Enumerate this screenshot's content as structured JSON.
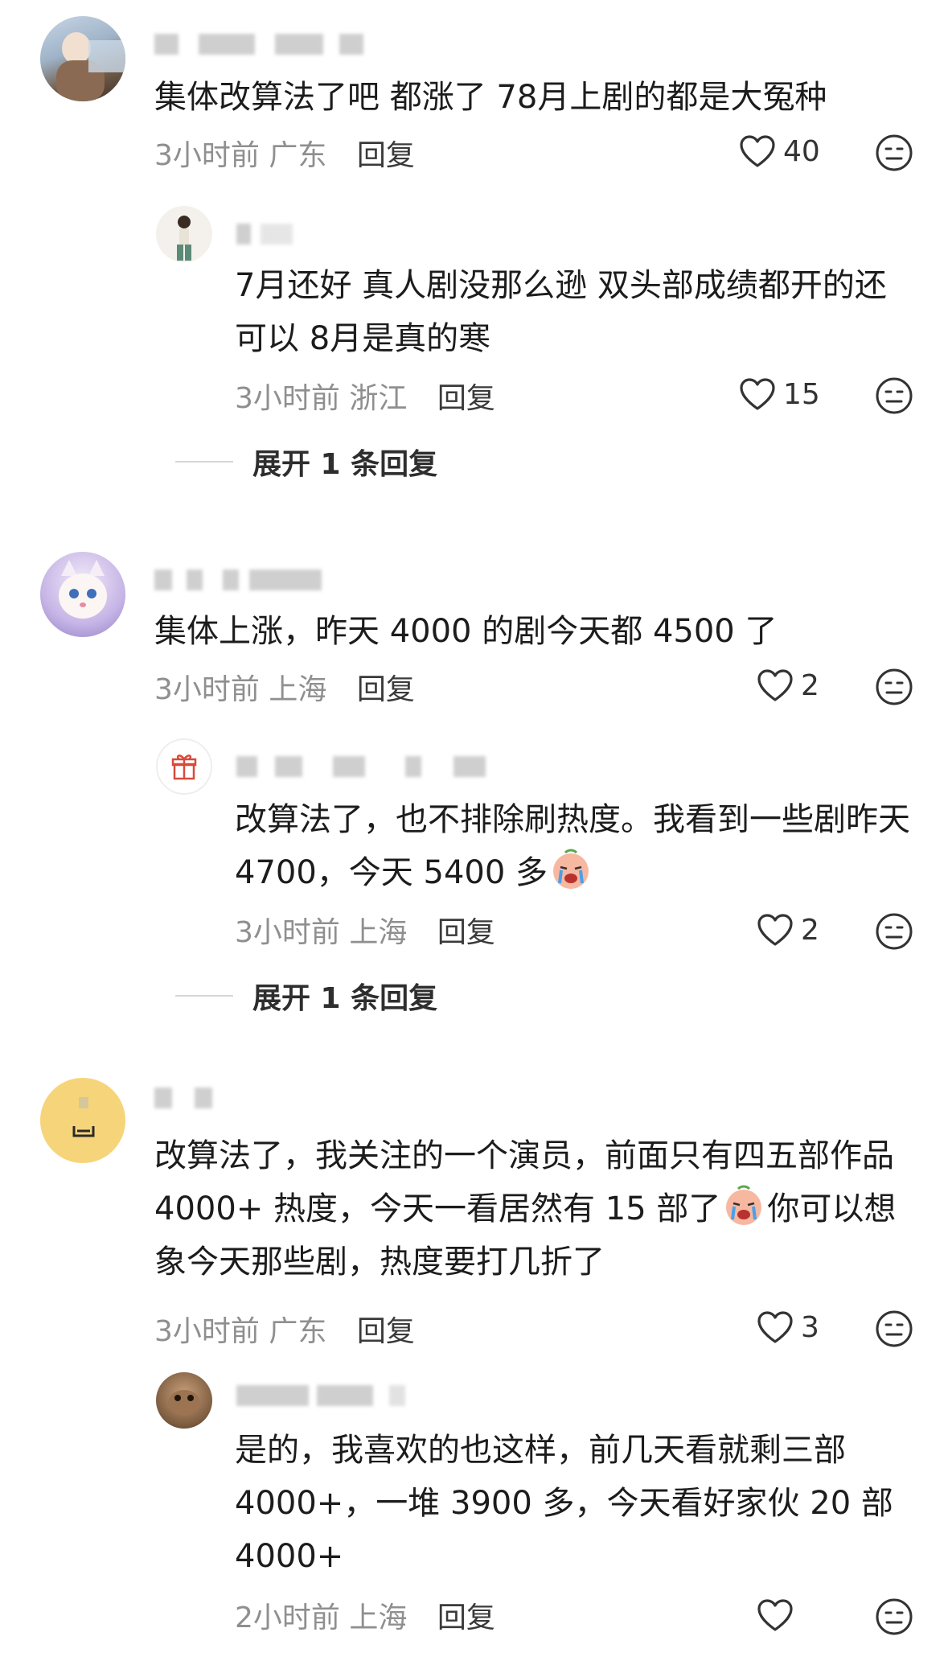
{
  "comments": [
    {
      "text": "集体改算法了吧 都涨了 78月上剧的都是大冤种",
      "time": "3小时前",
      "location": "广东",
      "reply_label": "回复",
      "likes": "40"
    },
    {
      "text": "7月还好 真人剧没那么逊 双头部成绩都开的还可以 8月是真的寒",
      "time": "3小时前",
      "location": "浙江",
      "reply_label": "回复",
      "likes": "15"
    },
    {
      "text": "集体上涨，昨天 4000 的剧今天都 4500 了",
      "time": "3小时前",
      "location": "上海",
      "reply_label": "回复",
      "likes": "2"
    },
    {
      "text": "改算法了，也不排除刷热度。我看到一些剧昨天 4700，今天 5400 多",
      "time": "3小时前",
      "location": "上海",
      "reply_label": "回复",
      "likes": "2"
    },
    {
      "text_a": "改算法了，我关注的一个演员，前面只有四五部作品 4000+ 热度，今天一看居然有 15 部了",
      "text_b": "你可以想象今天那些剧，热度要打几折了",
      "time": "3小时前",
      "location": "广东",
      "reply_label": "回复",
      "likes": "3"
    },
    {
      "text": "是的，我喜欢的也这样，前几天看就剩三部 4000+，一堆 3900 多，今天看好家伙 20 部 4000+",
      "time": "2小时前",
      "location": "上海",
      "reply_label": "回复",
      "likes": ""
    }
  ],
  "expand": [
    {
      "label": "展开 1 条回复"
    },
    {
      "label": "展开 1 条回复"
    }
  ],
  "icons": {
    "like": "heart-outline-icon",
    "dislike": "meh-face-icon",
    "emoji": "crying-face-emoji",
    "gift": "gift-icon"
  },
  "colors": {
    "meta_text": "#8f8f8f",
    "icon_stroke": "#333333"
  }
}
